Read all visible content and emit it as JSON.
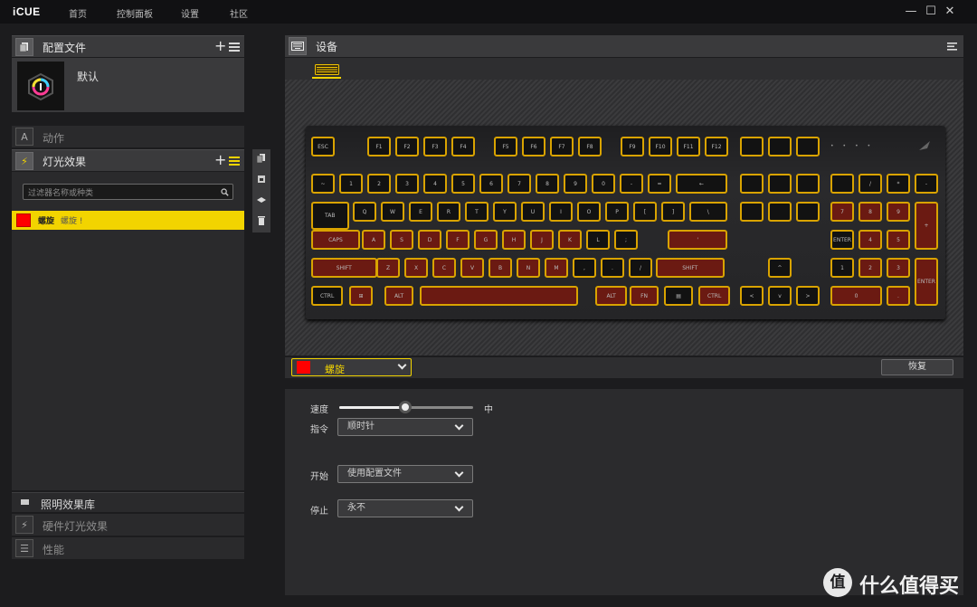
{
  "app": {
    "title": "iCUE"
  },
  "nav": [
    "首页",
    "控制面板",
    "设置",
    "社区"
  ],
  "window": {
    "minimize": "—",
    "maximize": "☐",
    "close": "✕"
  },
  "profiles": {
    "title": "配置文件",
    "add": "+",
    "item": "默认"
  },
  "actions": {
    "label": "动作"
  },
  "lighting": {
    "title": "灯光效果",
    "add": "+",
    "search_placeholder": "过滤器名称或种类",
    "effect_name": "螺旋",
    "effect_sub": "螺旋 !"
  },
  "library": {
    "label": "照明效果库"
  },
  "hw_lighting": {
    "label": "硬件灯光效果"
  },
  "performance": {
    "label": "性能"
  },
  "devices": {
    "title": "设备"
  },
  "effect_selector": {
    "label": "螺旋",
    "color": "#ff0000",
    "reset": "恢复"
  },
  "settings": {
    "speed": {
      "label": "速度",
      "value_label": "中",
      "level": 0.5
    },
    "direction": {
      "label": "指令",
      "value": "顺时针"
    },
    "start": {
      "label": "开始",
      "value": "使用配置文件"
    },
    "stop": {
      "label": "停止",
      "value": "永不"
    }
  },
  "watermark": {
    "text": "什么值得买",
    "logo_char": "值"
  },
  "keyboard": {
    "row0": [
      "ESC",
      "F1",
      "F2",
      "F3",
      "F4",
      "F5",
      "F6",
      "F7",
      "F8",
      "F9",
      "F10",
      "F11",
      "F12",
      "",
      "",
      "",
      ""
    ],
    "row1": [
      "~",
      "1",
      "2",
      "3",
      "4",
      "5",
      "6",
      "7",
      "8",
      "9",
      "0",
      "-",
      "=",
      "←",
      "",
      "",
      "",
      "",
      "/",
      "*",
      "-"
    ],
    "row2": [
      "TAB",
      "Q",
      "W",
      "E",
      "R",
      "T",
      "Y",
      "U",
      "I",
      "O",
      "P",
      "[",
      "]",
      "\\",
      "",
      "",
      "",
      "7",
      "8",
      "9",
      "+"
    ],
    "row3": [
      "CAPS",
      "A",
      "S",
      "D",
      "F",
      "G",
      "H",
      "J",
      "K",
      "L",
      ";",
      "'",
      "ENTER",
      "4",
      "5",
      "6"
    ],
    "row4": [
      "SHIFT",
      "Z",
      "X",
      "C",
      "V",
      "B",
      "N",
      "M",
      ",",
      ".",
      "/",
      "SHIFT",
      "^",
      "1",
      "2",
      "3",
      "ENTER"
    ],
    "row5": [
      "CTRL",
      "⊞",
      "ALT",
      "",
      "ALT",
      "FN",
      "▤",
      "CTRL",
      "<",
      "v",
      ">",
      "0",
      "."
    ]
  },
  "colors": {
    "accent": "#f2d400",
    "key_border": "#d9a300",
    "key_red": "#6b1a12"
  }
}
